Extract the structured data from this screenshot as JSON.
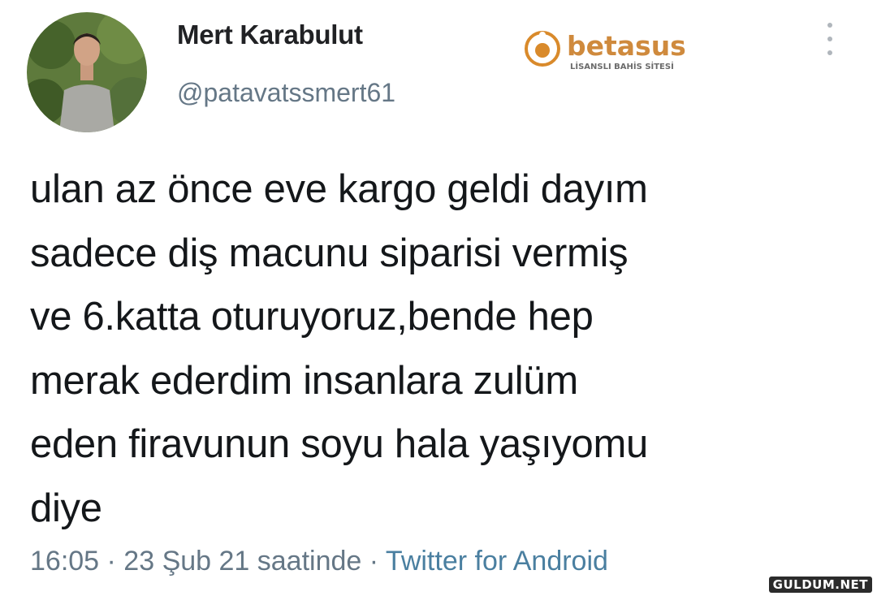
{
  "author": {
    "name": "Mert Karabulut",
    "handle": "@patavatssmert61"
  },
  "brand": {
    "name": "betasus",
    "tagline": "LİSANSLI BAHİS SİTESİ"
  },
  "tweet": {
    "text": "ulan az önce eve kargo geldi dayım\nsadece diş macunu siparisi vermiş\nve 6.katta oturuyoruz,bende hep\nmerak ederdim insanlara zulüm\neden firavunun soyu hala yaşıyomu\ndiye",
    "timestamp": "16:05 · 23 Şub 21 saatinde · ",
    "client": "Twitter for Android"
  },
  "watermark": "GULDUM.NET",
  "icons": {
    "more": "more-vertical-icon",
    "avatar": "avatar-photo"
  },
  "colors": {
    "handle": "#657786",
    "client": "#4a7fa0",
    "brand_orange": "#d98a2b"
  }
}
